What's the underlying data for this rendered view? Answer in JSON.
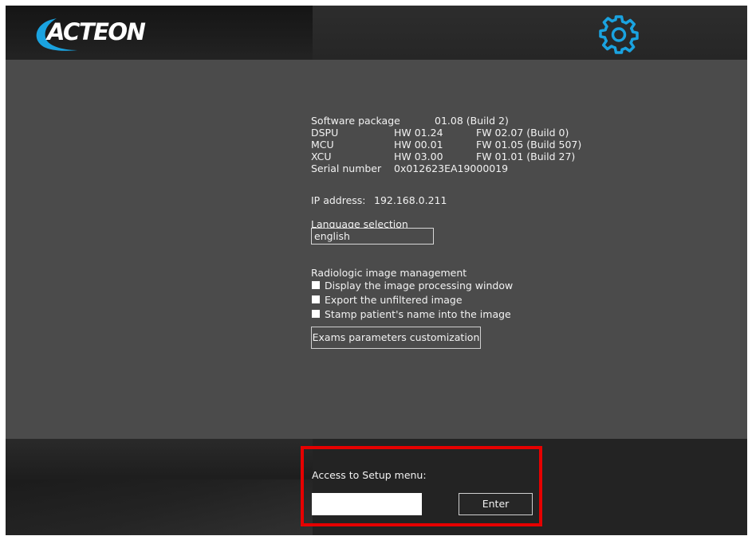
{
  "header": {
    "logo_text": "ACTEON",
    "settings_icon": "gear-icon",
    "accent_color": "#1aa3e0"
  },
  "info": {
    "software_package": {
      "label": "Software package",
      "value": "01.08 (Build 2)"
    },
    "dspu": {
      "label": "DSPU",
      "hw": "HW 01.24",
      "fw": "FW 02.07 (Build 0)"
    },
    "mcu": {
      "label": "MCU",
      "hw": "HW 00.01",
      "fw": "FW 01.05 (Build 507)"
    },
    "xcu": {
      "label": "XCU",
      "hw": "HW 03.00",
      "fw": "FW 01.01 (Build 27)"
    },
    "serial": {
      "label": "Serial number",
      "value": "0x012623EA19000019"
    },
    "ip": {
      "label": "IP address:",
      "value": "192.168.0.211"
    }
  },
  "language": {
    "label": "Language selection",
    "value": "english"
  },
  "radiologic": {
    "title": "Radiologic image management",
    "options": [
      {
        "label": "Display the image processing window",
        "checked": false
      },
      {
        "label": "Export the unfiltered image",
        "checked": false
      },
      {
        "label": "Stamp patient's name into the image",
        "checked": false
      }
    ],
    "exams_button": "Exams parameters customization"
  },
  "setup": {
    "label": "Access to Setup menu:",
    "input_value": "",
    "enter_button": "Enter",
    "highlight_color": "#e60000"
  }
}
